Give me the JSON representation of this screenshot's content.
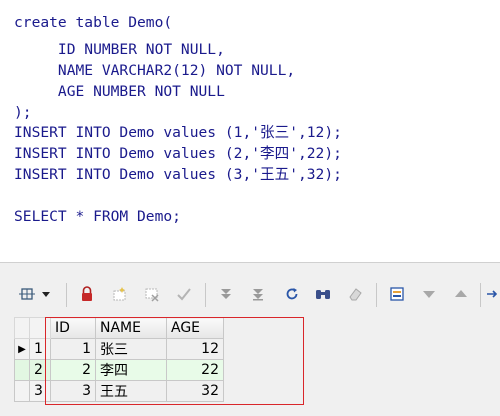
{
  "editor": {
    "lines": [
      "create table Demo(",
      "     ID NUMBER NOT NULL,",
      "     NAME VARCHAR2(12) NOT NULL,",
      "     AGE NUMBER NOT NULL",
      ");",
      "INSERT INTO Demo values (1,'张三',12);",
      "INSERT INTO Demo values (2,'李四',22);",
      "INSERT INTO Demo values (3,'王五',32);",
      "",
      "SELECT * FROM Demo;"
    ]
  },
  "toolbar": {
    "icons": [
      "grid-options-icon",
      "dropdown-arrow-icon",
      "lock-icon",
      "insert-record-icon",
      "delete-record-icon",
      "post-changes-icon",
      "next-page-icon",
      "last-page-icon",
      "refresh-icon",
      "query-by-example-icon",
      "clear-icon",
      "export-icon",
      "sort-down-icon",
      "sort-up-icon",
      "more-icon"
    ]
  },
  "grid": {
    "columns": [
      "ID",
      "NAME",
      "AGE"
    ],
    "rows": [
      {
        "rownum": "1",
        "id": "1",
        "name": "张三",
        "age": "12",
        "current": true
      },
      {
        "rownum": "2",
        "id": "2",
        "name": "李四",
        "age": "22",
        "selected": true
      },
      {
        "rownum": "3",
        "id": "3",
        "name": "王五",
        "age": "32"
      }
    ]
  },
  "colors": {
    "code": "#1a1a8c",
    "highlight_box": "#d9262a",
    "selected_row": "#e8fbe8"
  }
}
